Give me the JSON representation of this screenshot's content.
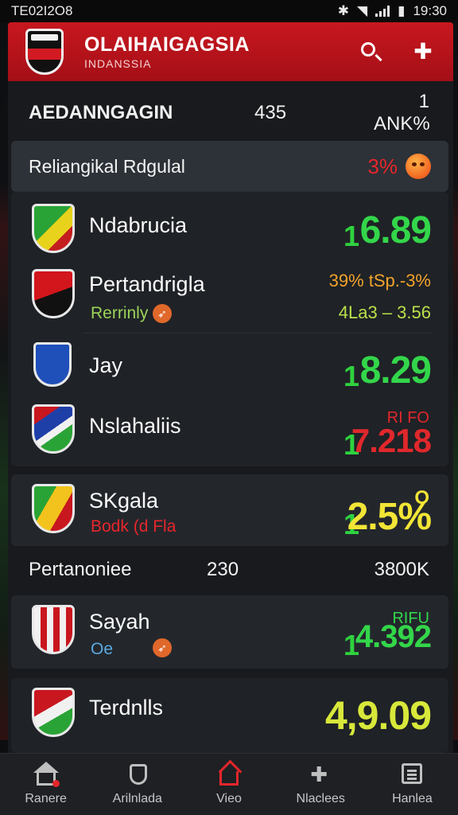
{
  "status_bar": {
    "left_text": "TE02I2O8",
    "time": "19:30"
  },
  "header": {
    "title": "OLAIHAIGAGSIA",
    "subtitle": "INDANSSIA"
  },
  "summary": {
    "label": "AEDANNGAGIN",
    "count": "435",
    "rate": "1 ANK%"
  },
  "section": {
    "title": "Reliangikal Rdgulal",
    "percent": "3%"
  },
  "matches": [
    {
      "name": "Ndabrucia",
      "odds_prefix": "1",
      "odds": "6.89",
      "odds_color": "#33d64a"
    },
    {
      "name": "Pertandrigla",
      "sub": "Rerrinly",
      "range_top": "39% tSp.-3%",
      "range_bottom": "4La3 – 3.56"
    },
    {
      "name": "Jay",
      "odds_prefix": "1",
      "odds": "8.29",
      "odds_color": "#33d64a"
    },
    {
      "name": "Nslahaliis",
      "odds_prefix": "1",
      "odds": "7.218",
      "odds_top": "RI FO",
      "odds_color": "#e0282c"
    },
    {
      "name": "SKgala",
      "sub": "Bodk (d Fla",
      "odds_prefix": "1",
      "odds": "2.5%",
      "odds_top": "O",
      "odds_color": "#f2e536"
    },
    {
      "name": "Sayah",
      "sub": "Oe",
      "odds_prefix": "1",
      "odds": "4.392",
      "odds_top": "RIFU",
      "odds_color": "#33d64a"
    },
    {
      "name": "Terdnlls",
      "odds": "4,9.09",
      "odds_color": "#d8e83a"
    }
  ],
  "group": {
    "label": "Pertanoniee",
    "count": "230",
    "value": "3800K"
  },
  "nav": [
    {
      "label": "Ranere",
      "icon": "home-icon"
    },
    {
      "label": "Arilnlada",
      "icon": "shield-icon"
    },
    {
      "label": "Vieo",
      "icon": "house-icon"
    },
    {
      "label": "Nlaclees",
      "icon": "puzzle-icon"
    },
    {
      "label": "Hanlea",
      "icon": "menu-icon"
    }
  ]
}
